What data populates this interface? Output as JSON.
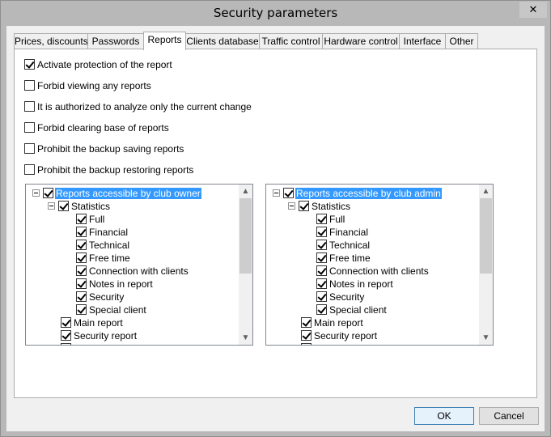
{
  "window": {
    "title": "Security parameters",
    "close_glyph": "✕"
  },
  "tabs": [
    {
      "label": "Prices, discounts"
    },
    {
      "label": "Passwords"
    },
    {
      "label": "Reports",
      "active": true
    },
    {
      "label": "Clients database"
    },
    {
      "label": "Traffic control"
    },
    {
      "label": "Hardware control"
    },
    {
      "label": "Interface"
    },
    {
      "label": "Other"
    }
  ],
  "options": [
    {
      "label": "Activate protection of the report",
      "checked": true
    },
    {
      "label": "Forbid viewing any reports",
      "checked": false
    },
    {
      "label": "It is authorized to analyze only the current change",
      "checked": false
    },
    {
      "label": "Forbid clearing base of reports",
      "checked": false
    },
    {
      "label": "Prohibit the backup saving reports",
      "checked": false
    },
    {
      "label": "Prohibit the backup restoring reports",
      "checked": false
    }
  ],
  "tree_owner": {
    "root": "Reports accessible by club owner",
    "statistics": "Statistics",
    "items": [
      "Full",
      "Financial",
      "Technical",
      "Free time",
      "Connection with clients",
      "Notes in report",
      "Security",
      "Special client"
    ],
    "after": [
      "Main report",
      "Security report"
    ]
  },
  "tree_admin": {
    "root": "Reports accessible by club admin",
    "statistics": "Statistics",
    "items": [
      "Full",
      "Financial",
      "Technical",
      "Free time",
      "Connection with clients",
      "Notes in report",
      "Security",
      "Special client"
    ],
    "after": [
      "Main report",
      "Security report"
    ]
  },
  "buttons": {
    "ok": "OK",
    "cancel": "Cancel"
  },
  "icons": {
    "close": "close-icon",
    "collapse": "minus-box-icon",
    "scroll_up": "▲",
    "scroll_down": "▼"
  }
}
